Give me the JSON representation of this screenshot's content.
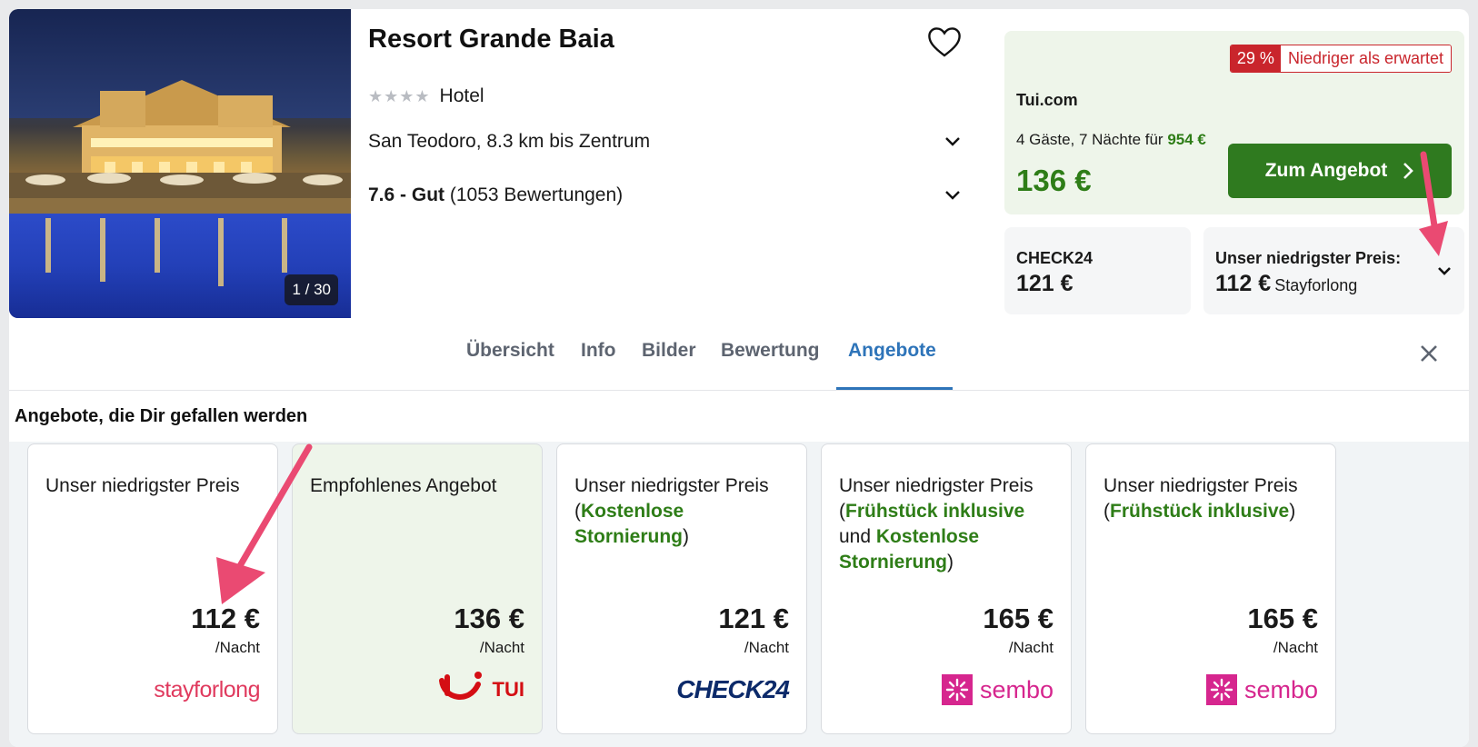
{
  "hotel": {
    "name": "Resort Grande Baia",
    "stars": "★★★★",
    "type": "Hotel",
    "location": "San Teodoro, 8.3 km bis Zentrum",
    "rating_score": "7.6 - Gut",
    "rating_count": "(1053 Bewertungen)",
    "photo_counter": "1 / 30"
  },
  "deal": {
    "badge_pct": "29 %",
    "badge_text": "Niedriger als erwartet",
    "provider": "Tui.com",
    "guests_text": "4 Gäste, 7 Nächte für",
    "total": "954 €",
    "price": "136 €",
    "cta": "Zum Angebot"
  },
  "alt_prices": [
    {
      "label": "CHECK24",
      "price": "121 €"
    },
    {
      "label": "Unser niedrigster Preis:",
      "price": "112 €",
      "provider": "Stayforlong"
    }
  ],
  "tabs": [
    "Übersicht",
    "Info",
    "Bilder",
    "Bewertung",
    "Angebote"
  ],
  "active_tab": "Angebote",
  "offers_title": "Angebote, die Dir gefallen werden",
  "offers": [
    {
      "head": "Unser niedrigster Preis",
      "price": "112 €",
      "per": "/Nacht",
      "logo": "stayforlong"
    },
    {
      "head": "Empfohlenes Angebot",
      "price": "136 €",
      "per": "/Nacht",
      "logo": "TUI"
    },
    {
      "head": "Unser niedrigster Preis",
      "extra1": "Kostenlose Stornierung",
      "price": "121 €",
      "per": "/Nacht",
      "logo": "CHECK24"
    },
    {
      "head": "Unser niedrigster Preis",
      "extra1": "Frühstück inklusive",
      "joiner": "und",
      "extra2": "Kostenlose Stornierung",
      "price": "165 €",
      "per": "/Nacht",
      "logo": "sembo"
    },
    {
      "head": "Unser niedrigster Preis",
      "extra1": "Frühstück inklusive",
      "price": "165 €",
      "per": "/Nacht",
      "logo": "sembo"
    }
  ],
  "colors": {
    "green": "#2e7d17",
    "cta": "#2f7a1f",
    "red": "#c9252c",
    "blue": "#2e74b9",
    "arrow": "#ea4a72"
  }
}
